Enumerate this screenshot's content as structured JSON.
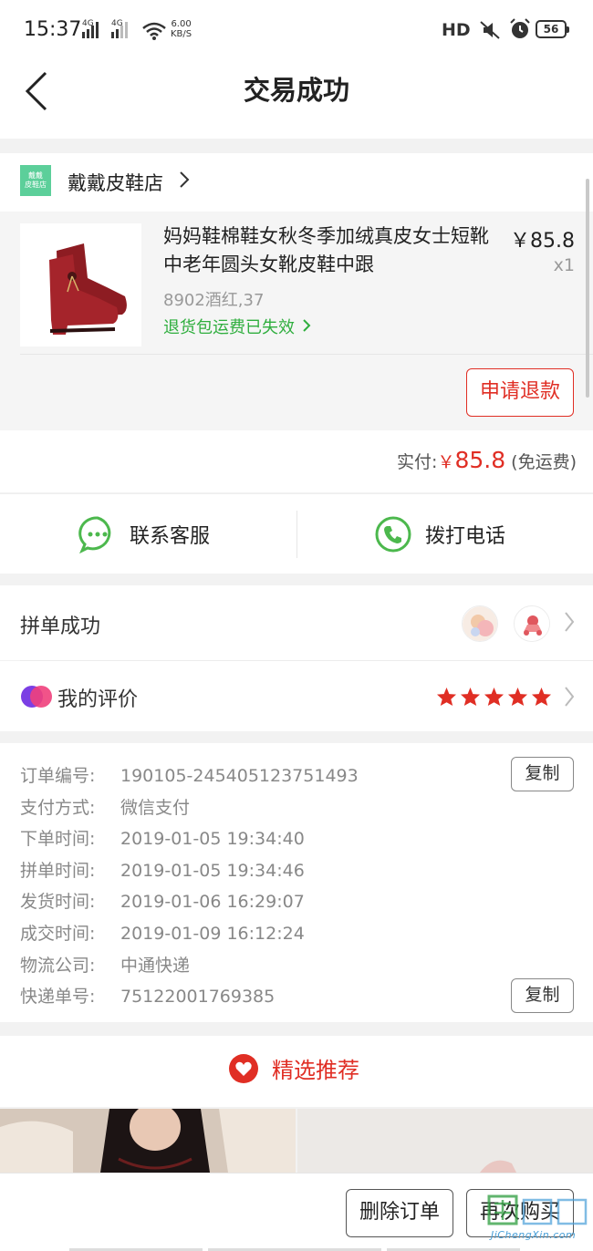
{
  "status_bar": {
    "time": "15:37",
    "network_1": "4G",
    "network_2": "4G",
    "speed_value": "6.00",
    "speed_unit": "KB/S",
    "hd_label": "HD",
    "battery": "56"
  },
  "header": {
    "title": "交易成功"
  },
  "shop": {
    "logo_text_1": "戴戴",
    "logo_text_2": "皮鞋店",
    "name": "戴戴皮鞋店"
  },
  "product": {
    "title": "妈妈鞋棉鞋女秋冬季加绒真皮女士短靴中老年圆头女靴皮鞋中跟",
    "price": "￥85.8",
    "quantity": "x1",
    "sku": "8902酒红,37",
    "return_note": "退货包运费已失效",
    "refund_button": "申请退款"
  },
  "payment": {
    "label": "实付:",
    "currency": "￥",
    "amount": "85.8",
    "note": "(免运费)"
  },
  "contact": {
    "service_label": "联系客服",
    "phone_label": "拨打电话"
  },
  "group": {
    "label": "拼单成功"
  },
  "review": {
    "label": "我的评价",
    "rating": 5,
    "rating_max": 5
  },
  "order_info": [
    {
      "key": "订单编号:",
      "value": "190105-245405123751493",
      "copyable": true,
      "copy_label": "复制"
    },
    {
      "key": "支付方式:",
      "value": "微信支付"
    },
    {
      "key": "下单时间:",
      "value": "2019-01-05 19:34:40"
    },
    {
      "key": "拼单时间:",
      "value": "2019-01-05 19:34:46"
    },
    {
      "key": "发货时间:",
      "value": "2019-01-06 16:29:07"
    },
    {
      "key": "成交时间:",
      "value": "2019-01-09 16:12:24"
    },
    {
      "key": "物流公司:",
      "value": "中通快递"
    },
    {
      "key": "快递单号:",
      "value": "75122001769385",
      "copyable": true,
      "copy_label": "复制"
    }
  ],
  "recommend": {
    "title": "精选推荐"
  },
  "bottom_bar": {
    "delete_order": "删除订单",
    "buy_again": "再次购买"
  },
  "watermark": {
    "site": "JiChengXin.com"
  },
  "colors": {
    "accent_red": "#e02e24",
    "green": "#2fae3e",
    "wechat_green": "#4cb84d"
  }
}
